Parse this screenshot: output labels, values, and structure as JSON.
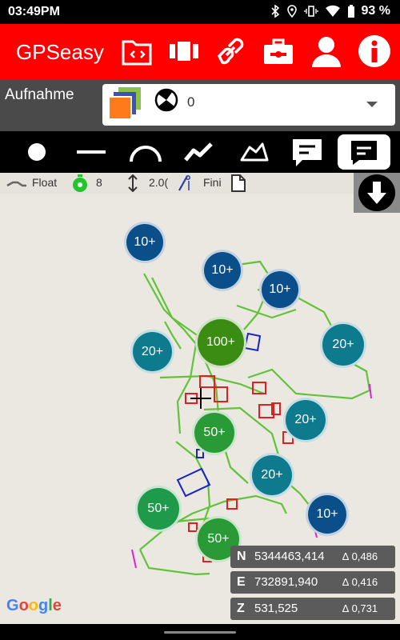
{
  "status": {
    "time": "03:49PM",
    "battery": "93 %"
  },
  "app": {
    "title": "GPSeasy"
  },
  "record": {
    "label": "Aufnahme",
    "value": "0"
  },
  "info": {
    "fix": "Float",
    "satellites": "8",
    "height": "2.0(",
    "file": "Fini"
  },
  "clusters": [
    {
      "label": "10+",
      "color": "#0a4f8a"
    },
    {
      "label": "10+",
      "color": "#0a4f8a"
    },
    {
      "label": "10+",
      "color": "#0a4f8a"
    },
    {
      "label": "20+",
      "color": "#0e7a8e"
    },
    {
      "label": "100+",
      "color": "#3a8d12"
    },
    {
      "label": "20+",
      "color": "#0e7a8e"
    },
    {
      "label": "50+",
      "color": "#2a9a36"
    },
    {
      "label": "20+",
      "color": "#0e7a8e"
    },
    {
      "label": "20+",
      "color": "#0e7a8e"
    },
    {
      "label": "50+",
      "color": "#1f9a4a"
    },
    {
      "label": "10+",
      "color": "#0a4f8a"
    },
    {
      "label": "50+",
      "color": "#2a9a36"
    }
  ],
  "coords": {
    "n": {
      "axis": "N",
      "value": "5344463,414",
      "acc": "∆ 0,486"
    },
    "e": {
      "axis": "E",
      "value": "732891,940",
      "acc": "∆ 0,416"
    },
    "z": {
      "axis": "Z",
      "value": "531,525",
      "acc": "∆ 0,731"
    }
  },
  "map": {
    "attribution": "Google"
  },
  "icons": [
    "bluetooth-icon",
    "location-icon",
    "vibrate-icon",
    "wifi-icon",
    "battery-icon",
    "folder-code-icon",
    "layers-icon",
    "link-icon",
    "toolbox-icon",
    "user-icon",
    "info-icon",
    "layers-stack-icon",
    "point-tool-icon",
    "line-tool-icon",
    "arc-tool-icon",
    "polyline-tool-icon",
    "polygon-tool-icon",
    "message-tool-icon",
    "message-active-tool-icon",
    "download-icon",
    "crosshair-icon"
  ]
}
